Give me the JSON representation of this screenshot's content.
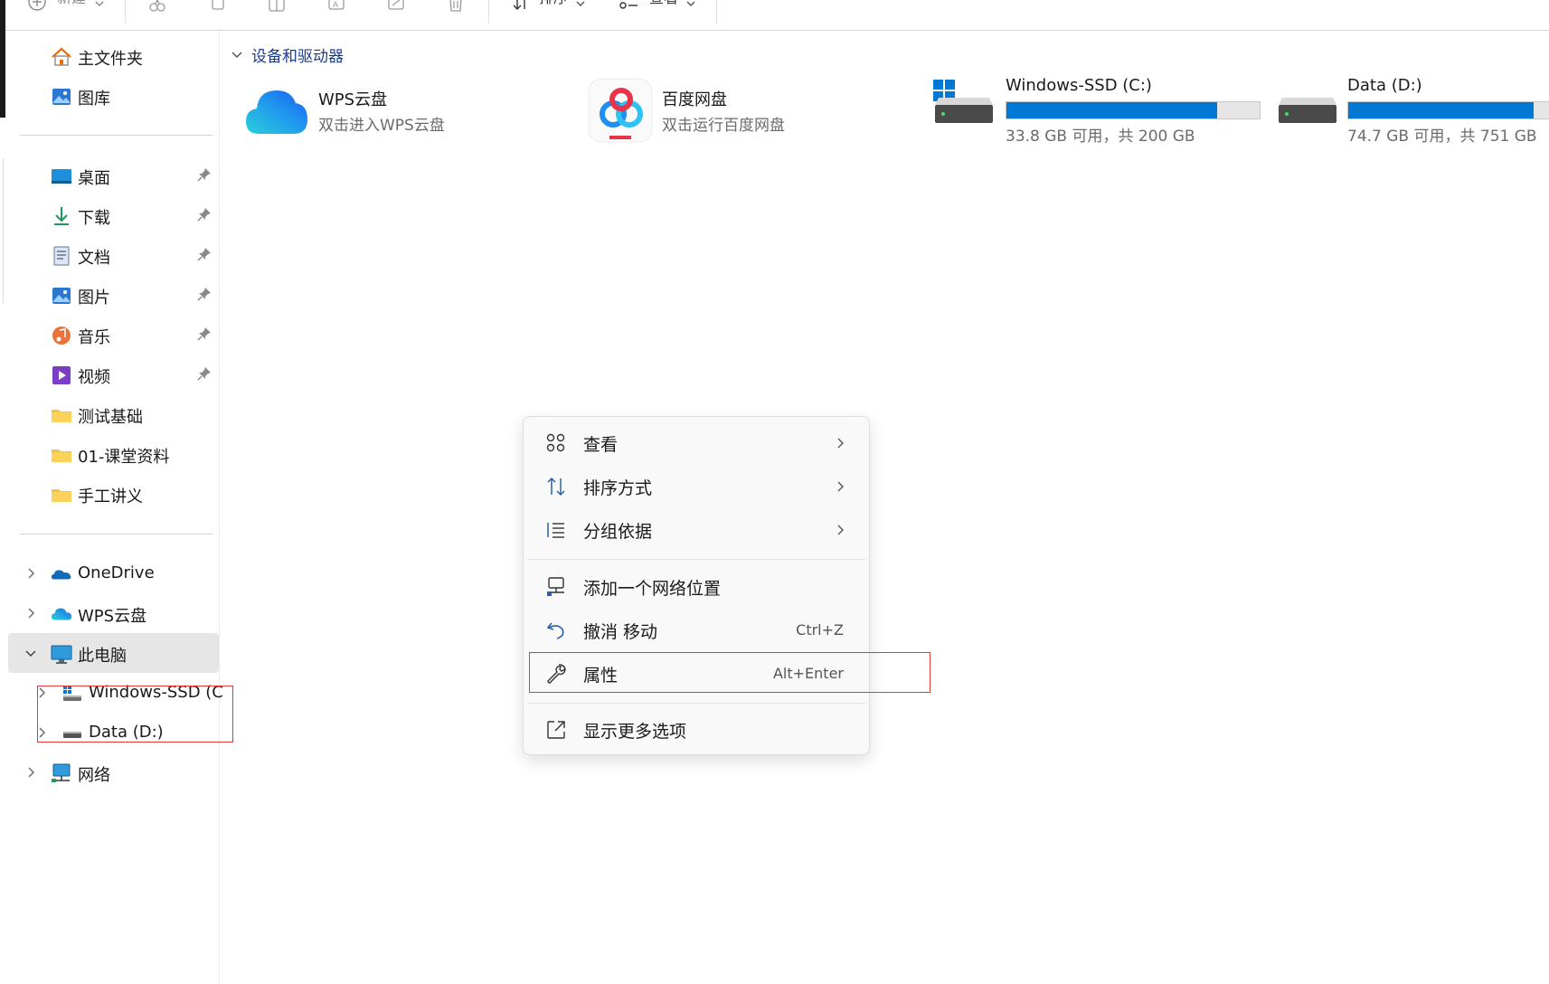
{
  "toolbar": {
    "new_label": "新建",
    "sort_label": "排序",
    "view_label": "查看",
    "more_label": "···"
  },
  "sidebar": {
    "quick": [
      {
        "label": "主文件夹",
        "icon": "home-icon"
      },
      {
        "label": "图库",
        "icon": "gallery-icon"
      }
    ],
    "pinned": [
      {
        "label": "桌面",
        "icon": "desktop-icon"
      },
      {
        "label": "下载",
        "icon": "download-icon"
      },
      {
        "label": "文档",
        "icon": "document-icon"
      },
      {
        "label": "图片",
        "icon": "pictures-icon"
      },
      {
        "label": "音乐",
        "icon": "music-icon"
      },
      {
        "label": "视频",
        "icon": "video-icon"
      },
      {
        "label": "测试基础",
        "icon": "folder-icon"
      },
      {
        "label": "01-课堂资料",
        "icon": "folder-icon"
      },
      {
        "label": "手工讲义",
        "icon": "folder-icon"
      }
    ],
    "tree": [
      {
        "label": "OneDrive",
        "icon": "onedrive-icon"
      },
      {
        "label": "WPS云盘",
        "icon": "wps-cloud-icon"
      },
      {
        "label": "此电脑",
        "icon": "this-pc-icon",
        "selected": true
      },
      {
        "label": "Windows-SSD (C",
        "icon": "windows-drive-icon"
      },
      {
        "label": "Data (D:)",
        "icon": "drive-icon"
      },
      {
        "label": "网络",
        "icon": "network-icon"
      }
    ]
  },
  "content": {
    "section_title": "设备和驱动器",
    "tiles": [
      {
        "name": "WPS云盘",
        "desc": "双击进入WPS云盘",
        "icon": "wps-cloud-icon"
      },
      {
        "name": "百度网盘",
        "desc": "双击运行百度网盘",
        "icon": "baidu-netdisk-icon"
      }
    ],
    "drives": [
      {
        "name": "Windows-SSD (C:)",
        "desc": "33.8 GB 可用，共 200 GB",
        "used_fraction": 0.831,
        "icon": "windows-drive-icon"
      },
      {
        "name": "Data (D:)",
        "desc": "74.7 GB 可用，共 751 GB",
        "used_fraction": 0.9,
        "icon": "drive-icon"
      }
    ]
  },
  "context_menu": {
    "items": [
      {
        "label": "查看",
        "icon": "grid-view-icon",
        "submenu": true
      },
      {
        "label": "排序方式",
        "icon": "sort-icon",
        "submenu": true
      },
      {
        "label": "分组依据",
        "icon": "group-by-icon",
        "submenu": true
      },
      {
        "label": "添加一个网络位置",
        "icon": "network-location-icon"
      },
      {
        "label": "撤消 移动",
        "icon": "undo-icon",
        "shortcut": "Ctrl+Z"
      },
      {
        "label": "属性",
        "icon": "wrench-icon",
        "shortcut": "Alt+Enter"
      },
      {
        "label": "显示更多选项",
        "icon": "external-icon"
      }
    ]
  },
  "colors": {
    "accent": "#0078d4",
    "highlight_box": "#e53935",
    "section_title": "#1a3c8c"
  }
}
